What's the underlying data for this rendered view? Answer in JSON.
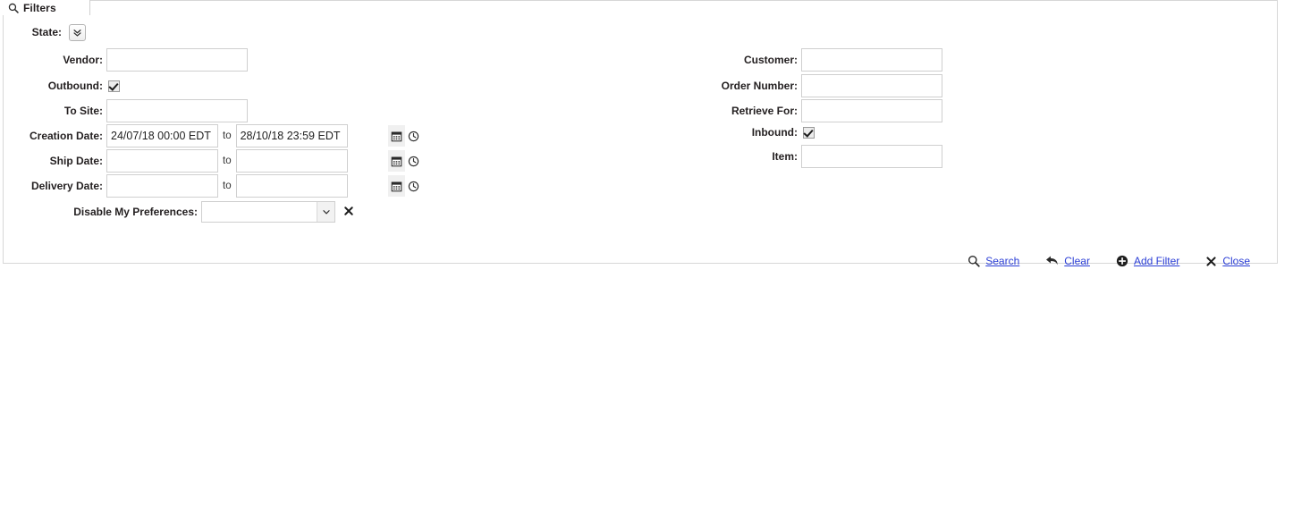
{
  "tab": {
    "label": "Filters",
    "icon": "search-icon"
  },
  "form": {
    "left_column": {
      "state": {
        "label": "State:",
        "button_icon": "double-chevron-down-icon"
      },
      "vendor": {
        "label": "Vendor:",
        "value": "",
        "placeholder": ""
      },
      "outbound": {
        "label": "Outbound:",
        "checked": true
      },
      "to_site": {
        "label": "To Site:",
        "value": "",
        "placeholder": ""
      },
      "creation_date": {
        "label": "Creation Date:",
        "from": "24/07/18 00:00 EDT",
        "to_label": "to",
        "to": "28/10/18 23:59 EDT",
        "calendar_icon": "calendar-icon",
        "clock_icon": "clock-icon"
      },
      "ship_date": {
        "label": "Ship Date:",
        "from": "",
        "to_label": "to",
        "to": ""
      },
      "delivery_date": {
        "label": "Delivery Date:",
        "from": "",
        "to_label": "to",
        "to": ""
      },
      "disable_my_preferences": {
        "label": "Disable My Preferences:",
        "value": "",
        "selected_option": "",
        "remove_icon": "close-x-icon"
      }
    },
    "right_column": {
      "customer": {
        "label": "Customer:",
        "value": "",
        "placeholder": ""
      },
      "order_number": {
        "label": "Order Number:",
        "value": "",
        "placeholder": ""
      },
      "retrieve_for": {
        "label": "Retrieve For:",
        "value": "",
        "placeholder": ""
      },
      "inbound": {
        "label": "Inbound:",
        "checked": true
      },
      "item": {
        "label": "Item:",
        "value": "",
        "placeholder": ""
      }
    }
  },
  "actions": {
    "search": {
      "label": "Search",
      "icon": "search-icon"
    },
    "clear": {
      "label": "Clear",
      "icon": "undo-arrow-icon"
    },
    "add_filter": {
      "label": "Add Filter",
      "icon": "plus-circle-icon"
    },
    "close": {
      "label": "Close",
      "icon": "close-x-icon"
    }
  },
  "colors": {
    "link": "#2b3ed6",
    "label_text": "#231f20",
    "border": "#d7d7d7",
    "field_border": "#cfcfcf"
  }
}
